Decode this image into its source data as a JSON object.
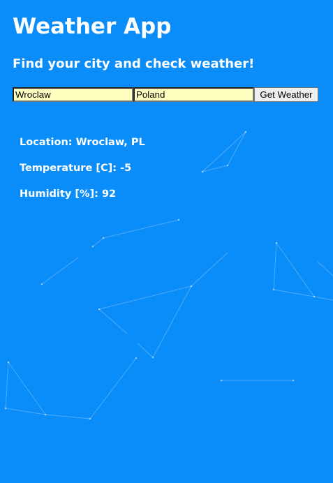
{
  "header": {
    "title": "Weather App",
    "subtitle": "Find your city and check weather!"
  },
  "form": {
    "city_value": "Wroclaw",
    "country_value": "Poland",
    "submit_label": "Get Weather"
  },
  "results": {
    "location_label": "Location:",
    "location_value": "Wroclaw, PL",
    "temperature_label": "Temperature [C]:",
    "temperature_value": "-5",
    "humidity_label": "Humidity [%]:",
    "humidity_value": "92"
  },
  "colors": {
    "background": "#0a8cf9",
    "text": "#ffffff",
    "input_background": "#ffffc0"
  }
}
